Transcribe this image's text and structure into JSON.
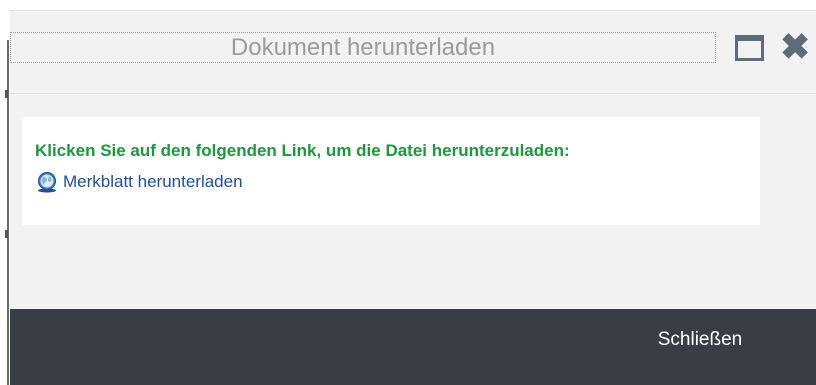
{
  "dialog": {
    "title": "Dokument herunterladen",
    "maximize_icon": "maximize-icon",
    "close_icon": "close-icon",
    "close_glyph": "✖",
    "instruction": "Klicken Sie auf den folgenden Link, um die Datei herunterzuladen:",
    "link": {
      "icon": "globe-icon",
      "label": "Merkblatt herunterladen"
    },
    "footer": {
      "close_label": "Schließen"
    }
  },
  "colors": {
    "instruction": "#1a9a3a",
    "link": "#1c4fa0",
    "footer_bg": "#393e44",
    "title_text": "#9b9b9b",
    "icons": "#5e6b78"
  }
}
